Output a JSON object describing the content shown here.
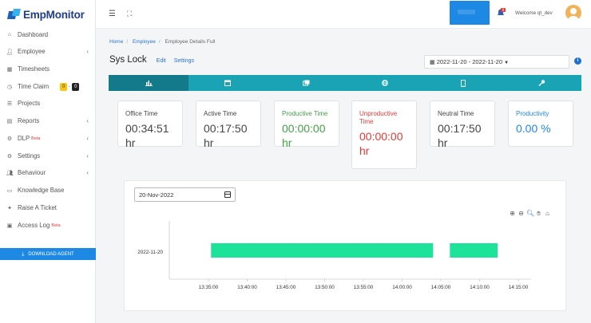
{
  "brand": {
    "name_prefix": "Emp",
    "name_suffix": "Monitor"
  },
  "sidebar": {
    "items": [
      {
        "label": "Dashboard",
        "icon": "home-icon"
      },
      {
        "label": "Employee",
        "icon": "user-icon",
        "chevron": true
      },
      {
        "label": "Timesheets",
        "icon": "calendar-icon"
      },
      {
        "label": "Time Claim",
        "icon": "clock-icon",
        "badges": [
          "0",
          "0"
        ]
      },
      {
        "label": "Projects",
        "icon": "list-icon"
      },
      {
        "label": "Reports",
        "icon": "report-icon",
        "chevron": true
      },
      {
        "label": "DLP",
        "icon": "gear-icon",
        "beta": "Beta",
        "chevron": true
      },
      {
        "label": "Settings",
        "icon": "gear-icon",
        "chevron": true
      },
      {
        "label": "Behaviour",
        "icon": "users-icon",
        "chevron": true
      },
      {
        "label": "Knowledge Base",
        "icon": "book-icon"
      },
      {
        "label": "Raise A Ticket",
        "icon": "ticket-icon"
      },
      {
        "label": "Access Log",
        "icon": "log-icon",
        "beta": "Beta"
      }
    ],
    "download_label": "DOWNLOAD AGENT"
  },
  "topbar": {
    "welcome": "Welcome qt_dev",
    "notification_count": "0"
  },
  "breadcrumb": {
    "home": "Home",
    "employee": "Employee",
    "current": "Employee Details Full"
  },
  "page": {
    "title": "Sys Lock",
    "edit": "Edit",
    "settings": "Settings",
    "date_range": "2022-11-20 - 2022-11-20"
  },
  "tabs": [
    "chart-icon",
    "calendar-icon",
    "screens-icon",
    "globe-icon",
    "mobile-icon",
    "key-icon"
  ],
  "cards": [
    {
      "label": "Office Time",
      "value": "00:34:51",
      "unit": "hr"
    },
    {
      "label": "Active Time",
      "value": "00:17:50",
      "unit": "hr"
    },
    {
      "label": "Productive Time",
      "value": "00:00:00",
      "unit": "hr"
    },
    {
      "label": "Unproductive Time",
      "value": "00:00:00",
      "unit": "hr"
    },
    {
      "label": "Neutral Time",
      "value": "00:17:50",
      "unit": "hr"
    },
    {
      "label": "Productivity",
      "value": "0.00 %"
    }
  ],
  "timeline": {
    "date_value": "20-Nov-2022",
    "row_label": "2022-11-20",
    "ticks": [
      "13:35:00",
      "13:40:00",
      "13:45:00",
      "13:50:00",
      "13:55:00",
      "14:00:00",
      "14:05:00",
      "14:10:00",
      "14:15:00"
    ],
    "bars": [
      {
        "start": "13:35:20",
        "end": "14:04:00"
      },
      {
        "start": "14:06:10",
        "end": "14:12:20"
      }
    ],
    "bar_color": "#1de39a"
  }
}
